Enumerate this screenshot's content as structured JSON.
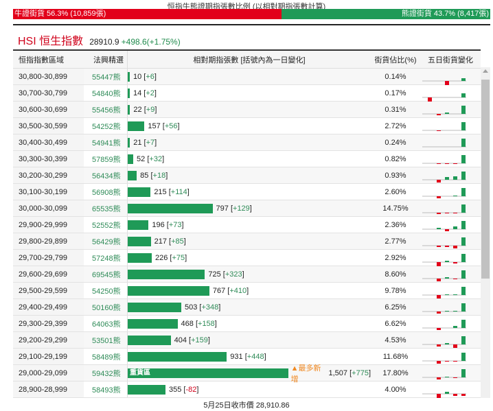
{
  "ratio": {
    "title": "恒指牛熊證期指張數比例 (以相對期指張數計算)",
    "bull_label": "牛證街貨 56.3% (10,859張)",
    "bear_label": "熊證街貨 43.7% (8,417張)",
    "bull_pct": 56.3
  },
  "index": {
    "name": "HSI 恒生指數",
    "price": "28910.9",
    "change": "+498.6(+1.75%)"
  },
  "headers": {
    "range": "恒指指數區域",
    "pick": "法興精選",
    "contracts": "相對期指張數 [括號內為一日變化]",
    "share": "街貨佔比(%)",
    "five_day": "五日街貨變化"
  },
  "colors": {
    "bull": "#e2001a",
    "bear": "#1f9a57"
  },
  "rows": [
    {
      "range": "30,800-30,899",
      "pick": "55447熊",
      "count": 10,
      "count_label": "10",
      "delta": "+6",
      "share": "0.14%",
      "five": [
        0,
        0,
        -10,
        0,
        4
      ]
    },
    {
      "range": "30,700-30,799",
      "pick": "54840熊",
      "count": 14,
      "count_label": "14",
      "delta": "+2",
      "share": "0.17%",
      "five": [
        -12,
        0,
        0,
        0,
        6
      ]
    },
    {
      "range": "30,600-30,699",
      "pick": "55456熊",
      "count": 22,
      "count_label": "22",
      "delta": "+9",
      "share": "0.31%",
      "five": [
        0,
        -2,
        2,
        0,
        12
      ]
    },
    {
      "range": "30,500-30,599",
      "pick": "54252熊",
      "count": 157,
      "count_label": "157",
      "delta": "+56",
      "share": "2.72%",
      "five": [
        0,
        -1,
        0,
        0,
        12
      ]
    },
    {
      "range": "30,400-30,499",
      "pick": "54941熊",
      "count": 21,
      "count_label": "21",
      "delta": "+7",
      "share": "0.24%",
      "five": [
        0,
        0,
        0,
        0,
        12
      ]
    },
    {
      "range": "30,300-30,399",
      "pick": "57859熊",
      "count": 52,
      "count_label": "52",
      "delta": "+32",
      "share": "0.82%",
      "five": [
        0,
        -1,
        -1,
        -1,
        12
      ]
    },
    {
      "range": "30,200-30,299",
      "pick": "56434熊",
      "count": 85,
      "count_label": "85",
      "delta": "+18",
      "share": "0.93%",
      "five": [
        0,
        -4,
        4,
        5,
        12
      ]
    },
    {
      "range": "30,100-30,199",
      "pick": "56908熊",
      "count": 215,
      "count_label": "215",
      "delta": "+114",
      "share": "2.60%",
      "five": [
        0,
        -3,
        0,
        1,
        12
      ]
    },
    {
      "range": "30,000-30,099",
      "pick": "65535熊",
      "count": 797,
      "count_label": "797",
      "delta": "+129",
      "share": "14.75%",
      "five": [
        0,
        -2,
        -1,
        -1,
        12
      ]
    },
    {
      "range": "29,900-29,999",
      "pick": "52552熊",
      "count": 196,
      "count_label": "196",
      "delta": "+73",
      "share": "2.36%",
      "five": [
        0,
        2,
        -3,
        4,
        12
      ]
    },
    {
      "range": "29,800-29,899",
      "pick": "56429熊",
      "count": 217,
      "count_label": "217",
      "delta": "+85",
      "share": "2.77%",
      "five": [
        0,
        -2,
        -2,
        -4,
        12
      ]
    },
    {
      "range": "29,700-29,799",
      "pick": "57248熊",
      "count": 226,
      "count_label": "226",
      "delta": "+75",
      "share": "2.92%",
      "five": [
        0,
        -7,
        2,
        -2,
        12
      ]
    },
    {
      "range": "29,600-29,699",
      "pick": "69545熊",
      "count": 725,
      "count_label": "725",
      "delta": "+323",
      "share": "8.60%",
      "five": [
        0,
        -4,
        2,
        -1,
        12
      ]
    },
    {
      "range": "29,500-29,599",
      "pick": "54250熊",
      "count": 767,
      "count_label": "767",
      "delta": "+410",
      "share": "9.78%",
      "five": [
        0,
        -5,
        1,
        1,
        12
      ]
    },
    {
      "range": "29,400-29,499",
      "pick": "50160熊",
      "count": 503,
      "count_label": "503",
      "delta": "+348",
      "share": "6.25%",
      "five": [
        0,
        -3,
        1,
        1,
        12
      ]
    },
    {
      "range": "29,300-29,399",
      "pick": "64063熊",
      "count": 468,
      "count_label": "468",
      "delta": "+158",
      "share": "6.62%",
      "five": [
        0,
        -3,
        0,
        3,
        12
      ]
    },
    {
      "range": "29,200-29,299",
      "pick": "53501熊",
      "count": 404,
      "count_label": "404",
      "delta": "+159",
      "share": "4.53%",
      "five": [
        0,
        -3,
        2,
        -5,
        12
      ]
    },
    {
      "range": "29,100-29,199",
      "pick": "58489熊",
      "count": 931,
      "count_label": "931",
      "delta": "+448",
      "share": "11.68%",
      "five": [
        0,
        -4,
        -1,
        -1,
        12
      ]
    },
    {
      "range": "29,000-29,099",
      "pick": "59432熊",
      "count": 1507,
      "count_label": "1,507",
      "delta": "+775",
      "share": "17.80%",
      "five": [
        0,
        -3,
        1,
        -1,
        12
      ],
      "bar_tag": "重貨區",
      "hot": "▲最多新增"
    },
    {
      "range": "28,900-28,999",
      "pick": "58493熊",
      "count": 355,
      "count_label": "355",
      "delta": "-82",
      "share": "4.00%",
      "five": [
        0,
        -12,
        3,
        -3,
        -3
      ]
    }
  ],
  "footer": "5月25日收市價 28,910.86"
}
